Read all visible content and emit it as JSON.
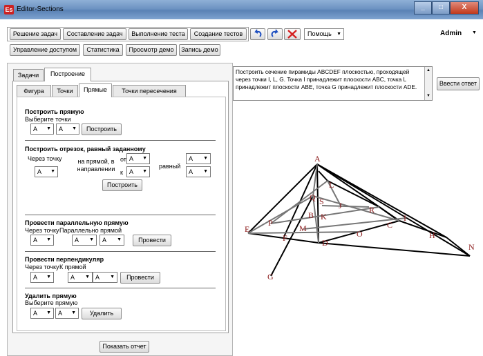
{
  "window": {
    "title": "Editor-Sections",
    "app_icon": "Es",
    "min": "_",
    "max": "□",
    "close": "X"
  },
  "menu": {
    "row1": [
      "Решение задач",
      "Составление задач",
      "Выполнение теста",
      "Создание тестов"
    ],
    "help": "Помощь",
    "user": "Admin",
    "row2": [
      "Управление доступом",
      "Статистика",
      "Просмотр демо",
      "Запись демо"
    ]
  },
  "tabs_outer": [
    "Задачи",
    "Построение"
  ],
  "tabs_inner": [
    "Фигура",
    "Точки",
    "Прямые",
    "Точки пересечения"
  ],
  "sections": {
    "line": {
      "title": "Построить прямую",
      "hint": "Выберите точки",
      "p1": "A",
      "p2": "A",
      "button": "Построить"
    },
    "segment": {
      "title": "Построить отрезок, равный заданному",
      "through": "Через точку",
      "on_line": "на прямой, в направлении",
      "from": "от",
      "to": "к",
      "equal": "равный",
      "v1": "A",
      "v2": "A",
      "v3": "A",
      "v4": "A",
      "v5": "A",
      "button": "Построить"
    },
    "parallel": {
      "title": "Провести параллельную прямую",
      "through": "Через точку",
      "parallel": "Параллельно прямой",
      "v1": "A",
      "v2": "A",
      "v3": "A",
      "button": "Провести"
    },
    "perp": {
      "title": "Провести перпендикуляр",
      "through": "Через точку",
      "to_line": "К прямой",
      "v1": "A",
      "v2": "A",
      "v3": "A",
      "button": "Провести"
    },
    "delete": {
      "title": "Удалить прямую",
      "hint": "Выберите прямую",
      "v1": "A",
      "v2": "A",
      "button": "Удалить"
    }
  },
  "report_button": "Показать отчет",
  "task_text": "Построить сечение пирамиды ABCDEF плоскостью, проходящей через точки I, L, G. Точка I принадлежит плоскости ABC, точка L принадлежит плоскости ABE, точка G принадлежит плоскости ADE.",
  "answer_button": "Ввести ответ",
  "figure_labels": [
    "A",
    "L",
    "Q",
    "S",
    "J",
    "R",
    "I",
    "B",
    "K",
    "M",
    "P",
    "E",
    "F",
    "D",
    "O",
    "C",
    "H",
    "N",
    "G"
  ]
}
